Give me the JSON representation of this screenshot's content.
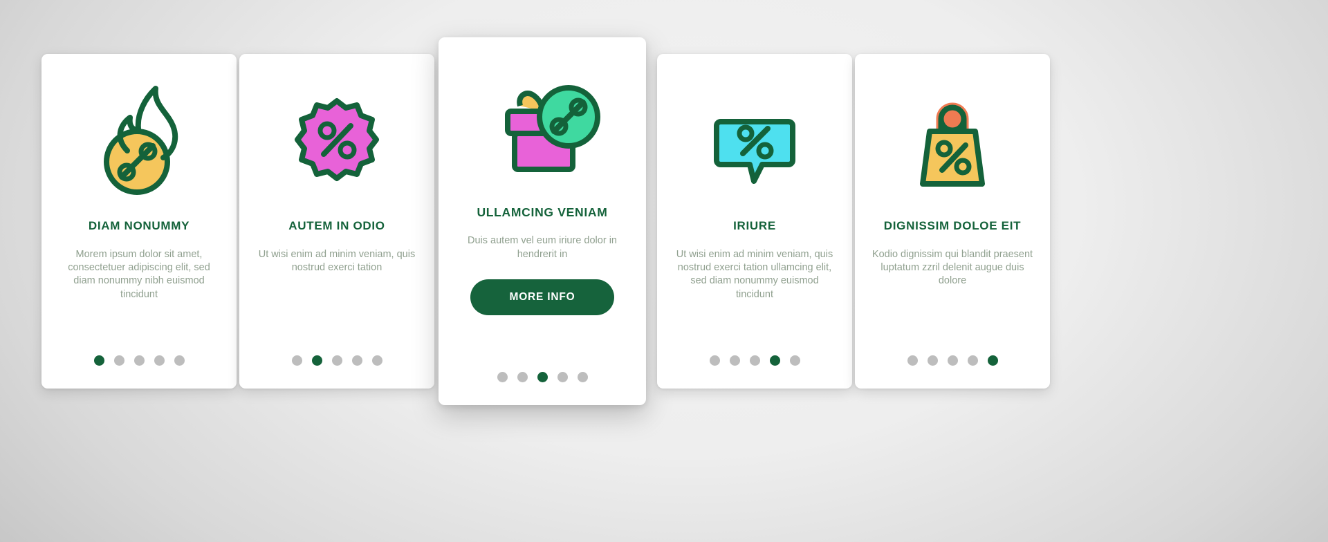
{
  "theme": {
    "brand_green": "#14623a",
    "button_green": "#16633c",
    "body_text": "#90a08f",
    "dot_inactive": "#bdbdbd",
    "icon_yellow": "#f5c65c",
    "icon_pink": "#e862d8",
    "icon_mint": "#3fd9a0",
    "icon_cyan": "#4ee0ef",
    "icon_orange": "#ef7b52",
    "card_bg": "#ffffff"
  },
  "cards": [
    {
      "id": "card-1",
      "icon_name": "flame-discount-icon",
      "title": "DIAM NONUMMY",
      "body": "Morem ipsum dolor sit amet, consectetuer adipiscing elit, sed diam nonummy nibh euismod tincidunt",
      "dots": {
        "count": 5,
        "active": 0
      },
      "featured": false,
      "cta": null
    },
    {
      "id": "card-2",
      "icon_name": "discount-badge-rosette-icon",
      "title": "AUTEM IN ODIO",
      "body": "Ut wisi enim ad minim veniam, quis nostrud exerci tation",
      "dots": {
        "count": 5,
        "active": 1
      },
      "featured": false,
      "cta": null
    },
    {
      "id": "card-3",
      "icon_name": "gift-box-discount-icon",
      "title": "ULLAMCING VENIAM",
      "body": "Duis autem vel eum iriure dolor in hendrerit in",
      "dots": {
        "count": 5,
        "active": 2
      },
      "featured": true,
      "cta": "MORE INFO"
    },
    {
      "id": "card-4",
      "icon_name": "chat-bubble-discount-icon",
      "title": "IRIURE",
      "body": "Ut wisi enim ad minim veniam, quis nostrud exerci tation ullamcing elit, sed diam nonummy euismod tincidunt",
      "dots": {
        "count": 5,
        "active": 3
      },
      "featured": false,
      "cta": null
    },
    {
      "id": "card-5",
      "icon_name": "shopping-bag-discount-icon",
      "title": "DIGNISSIM DOLOE EIT",
      "body": "Kodio dignissim qui blandit praesent luptatum zzril delenit augue duis dolore",
      "dots": {
        "count": 5,
        "active": 4
      },
      "featured": false,
      "cta": null
    }
  ]
}
